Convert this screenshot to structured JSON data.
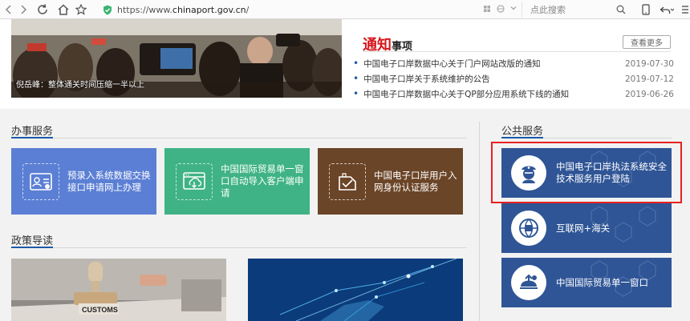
{
  "browser": {
    "url_prefix": "https://www.",
    "url_domain": "chinaport.gov.cn",
    "url_suffix": "/",
    "search_placeholder": "点此搜索"
  },
  "news_photo": {
    "caption": "倪岳峰：整体通关时间压缩一半以上"
  },
  "notices": {
    "title_big": "通知",
    "title_small": "事项",
    "more_label": "查看更多",
    "items": [
      {
        "text": "中国电子口岸数据中心关于门户网站改版的通知",
        "date": "2019-07-30"
      },
      {
        "text": "中国电子口岸关于系统维护的公告",
        "date": "2019-07-12"
      },
      {
        "text": "中国电子口岸数据中心关于QP部分应用系统下线的通知",
        "date": "2019-06-26"
      }
    ]
  },
  "sections": {
    "office": "办事服务",
    "policy": "政策导读",
    "public": "公共服务"
  },
  "office_services": [
    {
      "label": "预录入系统数据交换接口申请网上办理",
      "color": "#5b7fd4"
    },
    {
      "label": "中国国际贸易单一窗口自动导入客户端申请",
      "color": "#3fb385"
    },
    {
      "label": "中国电子口岸用户入网身份认证服务",
      "color": "#6b4527"
    }
  ],
  "public_services": [
    {
      "label": "中国电子口岸执法系统安全技术服务用户登陆"
    },
    {
      "label": "互联网+海关"
    },
    {
      "label": "中国国际贸易单一窗口"
    }
  ],
  "policy_images": {
    "customs_stamp": "CUSTOMS"
  },
  "colors": {
    "accent_blue": "#1b5aa8",
    "public_card_blue": "#2f5596",
    "highlight_red": "#e8201e",
    "notice_red": "#d7161c"
  }
}
